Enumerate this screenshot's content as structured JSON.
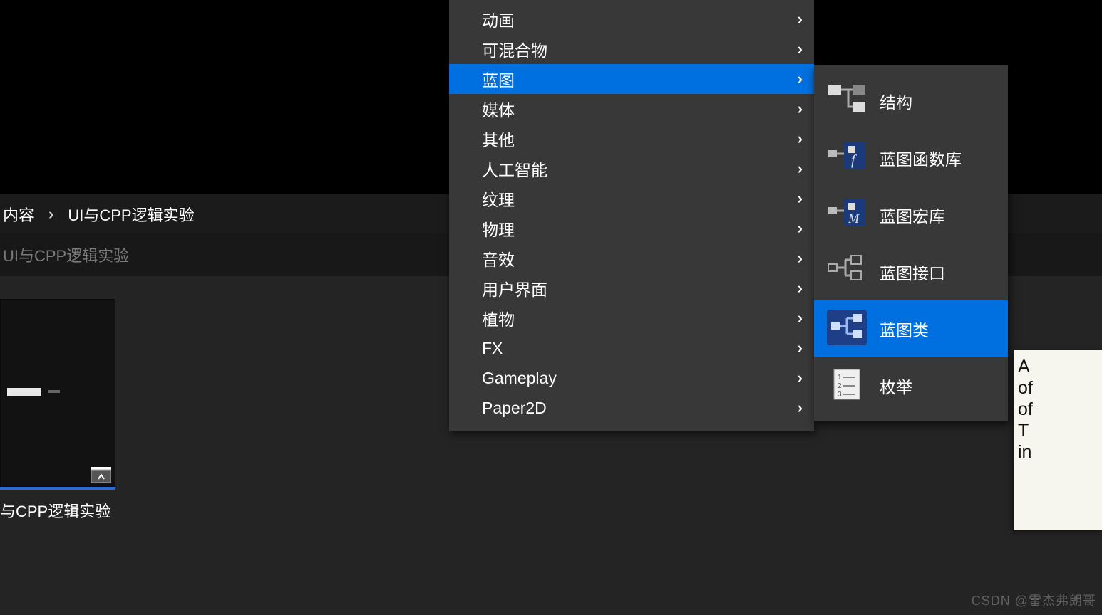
{
  "breadcrumb": {
    "seg0": "内容",
    "seg1": "UI与CPP逻辑实验"
  },
  "filter_bar": {
    "text": "UI与CPP逻辑实验"
  },
  "asset": {
    "label": "与CPP逻辑实验"
  },
  "main_menu": {
    "items": [
      {
        "label": "动画",
        "has_submenu": true,
        "selected": false
      },
      {
        "label": "可混合物",
        "has_submenu": true,
        "selected": false
      },
      {
        "label": "蓝图",
        "has_submenu": true,
        "selected": true
      },
      {
        "label": "媒体",
        "has_submenu": true,
        "selected": false
      },
      {
        "label": "其他",
        "has_submenu": true,
        "selected": false
      },
      {
        "label": "人工智能",
        "has_submenu": true,
        "selected": false
      },
      {
        "label": "纹理",
        "has_submenu": true,
        "selected": false
      },
      {
        "label": "物理",
        "has_submenu": true,
        "selected": false
      },
      {
        "label": "音效",
        "has_submenu": true,
        "selected": false
      },
      {
        "label": "用户界面",
        "has_submenu": true,
        "selected": false
      },
      {
        "label": "植物",
        "has_submenu": true,
        "selected": false
      },
      {
        "label": "FX",
        "has_submenu": true,
        "selected": false
      },
      {
        "label": "Gameplay",
        "has_submenu": true,
        "selected": false
      },
      {
        "label": "Paper2D",
        "has_submenu": true,
        "selected": false
      }
    ]
  },
  "submenu": {
    "items": [
      {
        "label": "结构",
        "icon": "struct-icon",
        "underline_color": "#2bd4c6",
        "selected": false
      },
      {
        "label": "蓝图函数库",
        "icon": "func-lib-icon",
        "underline_color": "#3b6fe0",
        "selected": false
      },
      {
        "label": "蓝图宏库",
        "icon": "macro-lib-icon",
        "underline_color": "#3b6fe0",
        "selected": false
      },
      {
        "label": "蓝图接口",
        "icon": "interface-icon",
        "underline_color": "#3b6fe0",
        "selected": false
      },
      {
        "label": "蓝图类",
        "icon": "blueprint-class-icon",
        "underline_color": "#3b6fe0",
        "selected": true
      },
      {
        "label": "枚举",
        "icon": "enum-icon",
        "underline_color": "#e6a6b8",
        "selected": false
      }
    ]
  },
  "tooltip": {
    "line0": "A",
    "line1": "of",
    "line2": "of",
    "line3": "T",
    "line4": "in"
  },
  "watermark": {
    "text": "CSDN @雷杰弗朗哥"
  }
}
